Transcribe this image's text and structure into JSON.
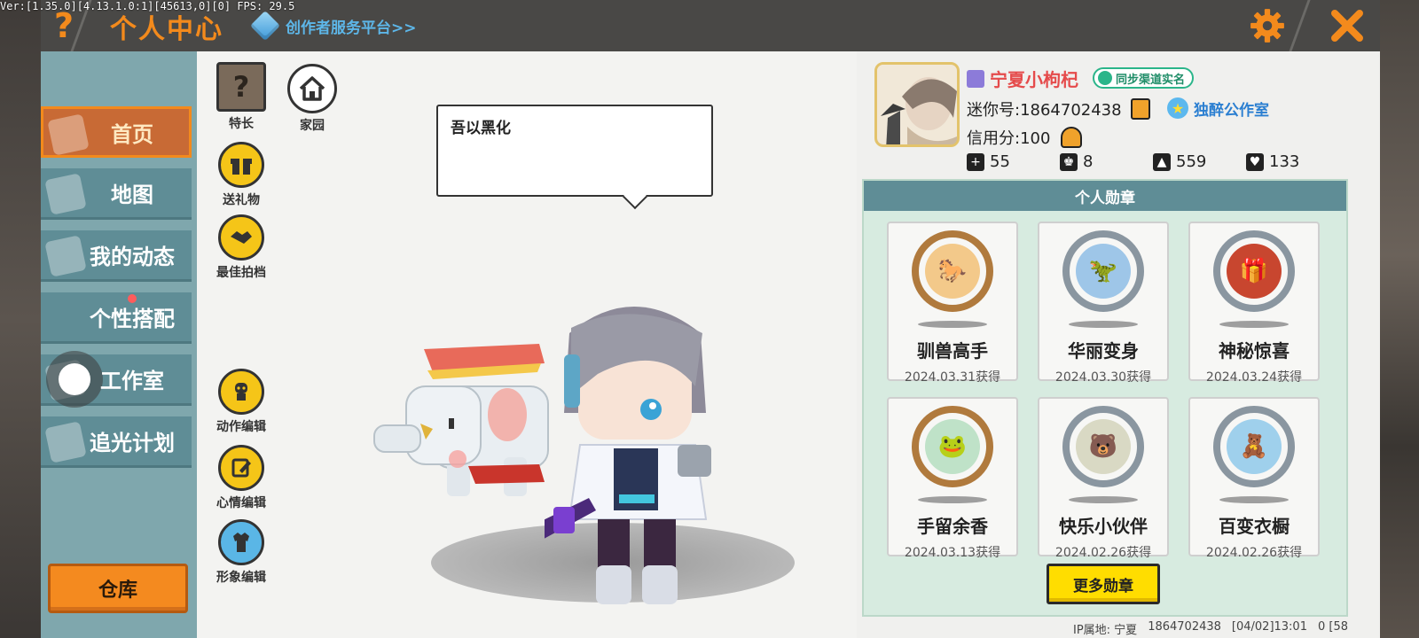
{
  "version_text": "Ver:[1.35.0][4.13.1.0:1][45613,0][0] FPS: 29.5",
  "header": {
    "help_icon": "?",
    "title": "个人中心",
    "creator_link": "创作者服务平台>>"
  },
  "sidebar": {
    "items": [
      {
        "label": "首页",
        "active": true
      },
      {
        "label": "地图",
        "active": false
      },
      {
        "label": "我的动态",
        "active": false
      },
      {
        "label": "个性搭配",
        "active": false
      },
      {
        "label": "工作室",
        "active": false
      },
      {
        "label": "追光计划",
        "active": false
      }
    ],
    "warehouse_label": "仓库"
  },
  "tools": {
    "specialty": "特长",
    "specialty_icon": "?",
    "home": "家园",
    "gift": "送礼物",
    "partner": "最佳拍档",
    "action_edit": "动作编辑",
    "mood_edit": "心情编辑",
    "appearance_edit": "形象编辑"
  },
  "speech_text": "吾以黑化",
  "profile": {
    "name": "宁夏小枸杞",
    "sync_label": "同步渠道实名",
    "mini_id": "迷你号:1864702438",
    "studio": "独醉公作室",
    "credit": "信用分:100",
    "stats": [
      {
        "icon": "plus-icon",
        "value": "55"
      },
      {
        "icon": "fans-icon",
        "value": "8"
      },
      {
        "icon": "fire-icon",
        "value": "559"
      },
      {
        "icon": "heart-icon",
        "value": "133"
      }
    ]
  },
  "medals": {
    "title": "个人勋章",
    "items": [
      {
        "name": "驯兽高手",
        "date": "2024.03.31获得",
        "ring": "bronze",
        "color": "#f3c98a"
      },
      {
        "name": "华丽变身",
        "date": "2024.03.30获得",
        "ring": "silver",
        "color": "#9ec6e8"
      },
      {
        "name": "神秘惊喜",
        "date": "2024.03.24获得",
        "ring": "silver",
        "color": "#c8462f"
      },
      {
        "name": "手留余香",
        "date": "2024.03.13获得",
        "ring": "bronze",
        "color": "#bfe2c8"
      },
      {
        "name": "快乐小伙伴",
        "date": "2024.02.26获得",
        "ring": "silver",
        "color": "#d9d9c4"
      },
      {
        "name": "百变衣橱",
        "date": "2024.02.26获得",
        "ring": "silver",
        "color": "#9fd0ec"
      }
    ],
    "more_label": "更多勋章"
  },
  "footer": {
    "ip": "IP属地: 宁夏",
    "id": "1864702438",
    "time": "[04/02]13:01",
    "extra": "0 [58"
  },
  "colors": {
    "accent": "#f38a1c",
    "sidebar_bg": "#7fa7ad",
    "title_bar": "#494846",
    "name_red": "#e54b4b"
  }
}
